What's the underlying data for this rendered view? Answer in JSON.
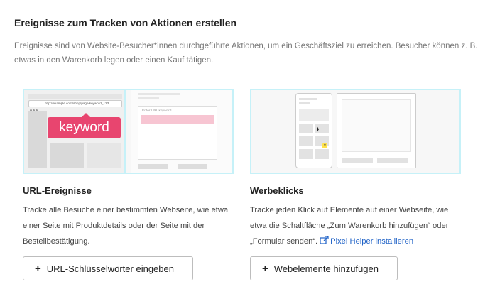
{
  "header": {
    "title": "Ereignisse zum Tracken von Aktionen erstellen",
    "intro": "Ereignisse sind von Website-Besucher*innen durchgeführte Aktionen, um ein Geschäftsziel zu erreichen. Besucher können z. B. etwas in den Warenkorb legen oder einen Kauf tätigen."
  },
  "cards": {
    "url": {
      "title": "URL-Ereignisse",
      "description": "Tracke alle Besuche einer bestimmten Webseite, wie etwa einer Seite mit Produktdetails oder der Seite mit der Bestellbestätigung.",
      "button_label": "URL-Schlüsselwörter eingeben",
      "illustration": {
        "badge_text": "keyword",
        "url_text": "http://example.com/shop/page/keyword_123",
        "field_label": "Enter URL keyword"
      }
    },
    "clicks": {
      "title": "Werbeklicks",
      "description": "Tracke jeden Klick auf Elemente auf einer Webseite, wie etwa die Schaltfläche „Zum Warenkorb hinzufügen“ oder „Formular senden“.",
      "link_label": "Pixel Helper installieren",
      "button_label": "Webelemente hinzufügen"
    }
  },
  "icons": {
    "plus": "+",
    "external_link": "external-link-icon"
  },
  "colors": {
    "accent_pink": "#e8456f",
    "frame_cyan": "#c6f1f8",
    "link_blue": "#1f62c7"
  }
}
